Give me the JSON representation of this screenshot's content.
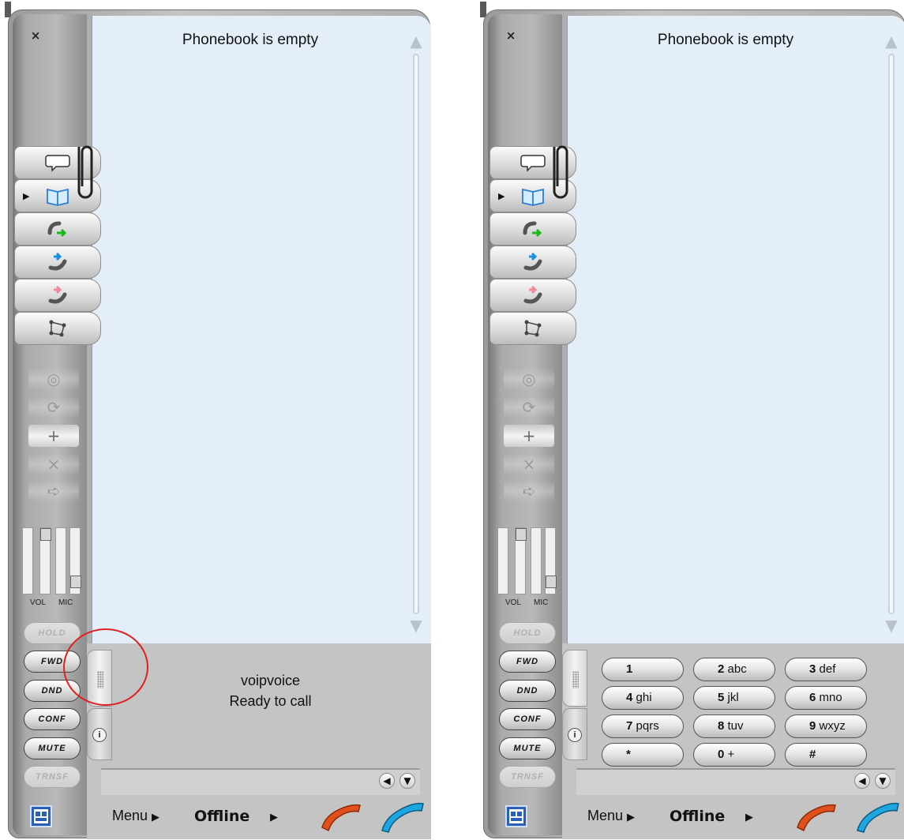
{
  "window": {
    "close_glyph": "×"
  },
  "phonebook": {
    "status": "Phonebook is empty"
  },
  "tabs": [
    {
      "name": "chat-tab",
      "icon": "speech-bubble-icon"
    },
    {
      "name": "phonebook-tab",
      "icon": "open-book-icon",
      "selected": true
    },
    {
      "name": "outgoing-calls-tab",
      "icon": "outgoing-call-icon"
    },
    {
      "name": "incoming-calls-tab",
      "icon": "incoming-call-icon"
    },
    {
      "name": "missed-calls-tab",
      "icon": "missed-call-icon"
    },
    {
      "name": "network-tab",
      "icon": "network-icon"
    }
  ],
  "audio": {
    "vol_label": "VOL",
    "mic_label": "MIC",
    "vol_level": 0.85,
    "mic_level": 0.2
  },
  "side_buttons": [
    {
      "label": "HOLD",
      "enabled": false
    },
    {
      "label": "FWD",
      "enabled": true
    },
    {
      "label": "DND",
      "enabled": true
    },
    {
      "label": "CONF",
      "enabled": true
    },
    {
      "label": "MUTE",
      "enabled": true
    },
    {
      "label": "TRNSF",
      "enabled": false
    }
  ],
  "status_panel": {
    "account": "voipvoice",
    "message": "Ready to call"
  },
  "info_label": "i",
  "keypad": [
    {
      "digit": "1",
      "letters": ""
    },
    {
      "digit": "2",
      "letters": "abc"
    },
    {
      "digit": "3",
      "letters": "def"
    },
    {
      "digit": "4",
      "letters": "ghi"
    },
    {
      "digit": "5",
      "letters": "jkl"
    },
    {
      "digit": "6",
      "letters": "mno"
    },
    {
      "digit": "7",
      "letters": "pqrs"
    },
    {
      "digit": "8",
      "letters": "tuv"
    },
    {
      "digit": "9",
      "letters": "wxyz"
    },
    {
      "digit": "*",
      "letters": ""
    },
    {
      "digit": "0",
      "letters": "+"
    },
    {
      "digit": "#",
      "letters": ""
    }
  ],
  "bottom": {
    "menu_label": "Menu",
    "status_label": "Offline",
    "caret": "▶"
  },
  "colors": {
    "panel": "#e4eef9",
    "hangup": "#e0501a",
    "call": "#1ea6e0",
    "annotation": "#e02020"
  }
}
